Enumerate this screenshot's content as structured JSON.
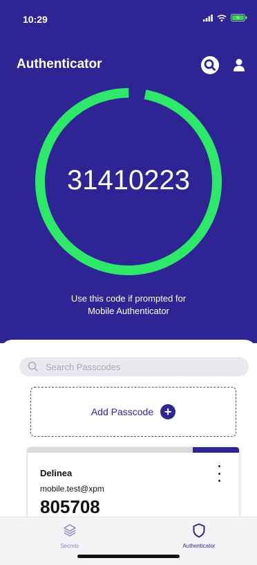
{
  "status_bar": {
    "time": "10:29"
  },
  "header": {
    "title": "Authenticator",
    "icons": [
      "search-icon",
      "user-icon"
    ]
  },
  "main_code": {
    "code": "31410223",
    "ring_progress": 0.97,
    "ring_color": "#2ee86a",
    "hint_line1": "Use this code if prompted for",
    "hint_line2": "Mobile Authenticator"
  },
  "search": {
    "placeholder": "Search Passcodes",
    "value": ""
  },
  "add_passcode": {
    "label": "Add Passcode"
  },
  "passcodes": [
    {
      "name": "Delinea",
      "account": "mobile.test@xpm",
      "code": "805708",
      "progress": 0.78
    }
  ],
  "tabs": [
    {
      "label": "Secrets",
      "icon": "layers-icon",
      "active": false
    },
    {
      "label": "Authenticator",
      "icon": "shield-icon",
      "active": true
    }
  ],
  "colors": {
    "brand": "#2e2493",
    "accent_green": "#2ee86a",
    "inactive": "#8a86c4"
  }
}
